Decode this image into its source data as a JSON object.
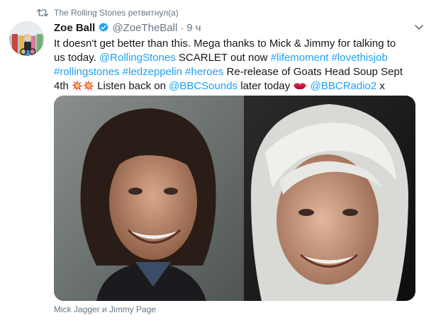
{
  "retweet": {
    "icon": "retweet-icon",
    "label": "The Rolling Stones ретвитнул(а)"
  },
  "tweet": {
    "avatar_icon": "avatar",
    "author_name": "Zoe Ball",
    "verified_icon": "verified-badge-icon",
    "handle": "@ZoeTheBall",
    "separator": "·",
    "time": "9 ч",
    "more_icon": "chevron-down-icon",
    "text": {
      "line1": "It doesn't get better than this. Mega thanks to Mick & Jimmy for talking to",
      "line2_plain": "us today. ",
      "mention_stones": "@RollingStones",
      "line2_after_mention": " SCARLET out now ",
      "hashtag_lifemoment": "#lifemoment",
      "hashtag_lovethisjob": "#lovethisjob",
      "hashtag_rollingstones": "#rollingstones",
      "hashtag_ledzeppelin": "#ledzeppelin",
      "hashtag_heroes": "#heroes",
      "line3_after_hashtags": " Re-release of Goats Head Soup Sept",
      "line4_start": "4th ",
      "line4_middle": " Listen back on ",
      "mention_bbcsounds": "@BBCSounds",
      "line4_after_sounds": " later today ",
      "mention_bbcradio2": "@BBCRadio2",
      "line4_end": " x"
    },
    "media_caption": "Mick Jagger и Jimmy Page"
  },
  "colors": {
    "link": "#1da1f2",
    "secondary_text": "#657786",
    "primary_text": "#14171a"
  }
}
